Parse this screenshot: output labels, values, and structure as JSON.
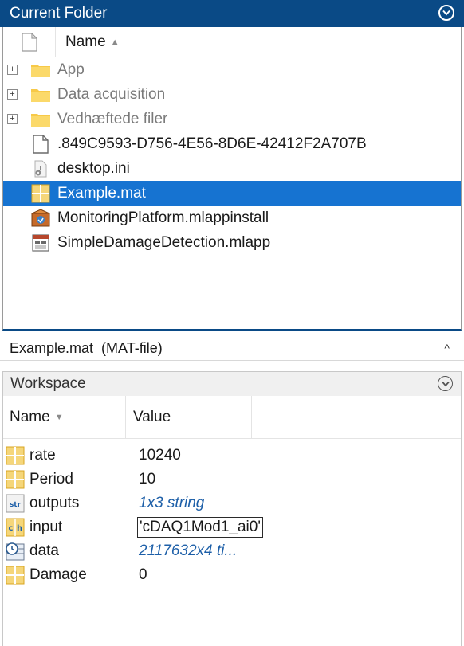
{
  "current_folder": {
    "title": "Current Folder",
    "column_name": "Name",
    "items": [
      {
        "name": "App",
        "kind": "folder",
        "expandable": true
      },
      {
        "name": "Data acquisition",
        "kind": "folder",
        "expandable": true
      },
      {
        "name": "Vedhæftede filer",
        "kind": "folder",
        "expandable": true
      },
      {
        "name": ".849C9593-D756-4E56-8D6E-42412F2A707B",
        "kind": "file",
        "icon": "blank-document-icon"
      },
      {
        "name": "desktop.ini",
        "kind": "file",
        "icon": "ini-file-icon"
      },
      {
        "name": "Example.mat",
        "kind": "file",
        "icon": "mat-file-icon",
        "selected": true
      },
      {
        "name": "MonitoringPlatform.mlappinstall",
        "kind": "file",
        "icon": "mlappinstall-icon"
      },
      {
        "name": "SimpleDamageDetection.mlapp",
        "kind": "file",
        "icon": "mlapp-icon"
      }
    ],
    "details": "Example.mat  (MAT-file)",
    "details_caret": "^"
  },
  "workspace": {
    "title": "Workspace",
    "column_name": "Name",
    "column_value": "Value",
    "variables": [
      {
        "name": "rate",
        "value": "10240",
        "icon": "matrix-icon",
        "style": "plain"
      },
      {
        "name": "Period",
        "value": "10",
        "icon": "matrix-icon",
        "style": "plain"
      },
      {
        "name": "outputs",
        "value": "1x3 string",
        "icon": "string-icon",
        "style": "italic"
      },
      {
        "name": "input",
        "value": "'cDAQ1Mod1_ai0'",
        "icon": "char-icon",
        "style": "boxed"
      },
      {
        "name": "data",
        "value": "2117632x4 ti...",
        "icon": "timetable-icon",
        "style": "italic"
      },
      {
        "name": "Damage",
        "value": "0",
        "icon": "matrix-icon",
        "style": "plain"
      }
    ]
  },
  "colors": {
    "title_bar": "#0a4a86",
    "selection": "#1673d1",
    "folder": "#f7c948",
    "italic_value": "#1d5fa8"
  }
}
